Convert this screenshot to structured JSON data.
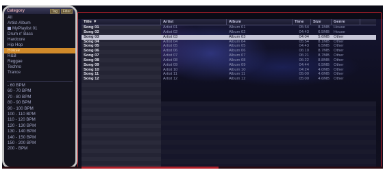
{
  "sidebar": {
    "title": "Category",
    "btn_tag": "Tag",
    "btn_filter": "Filter",
    "categories": [
      {
        "label": "All",
        "selected": false,
        "icon": ""
      },
      {
        "label": "Artist-Album",
        "selected": false,
        "icon": ""
      },
      {
        "label": "MyPlaylist 01",
        "selected": false,
        "icon": "playlist-icon"
      },
      {
        "label": "Drum n' Bass",
        "selected": false,
        "icon": ""
      },
      {
        "label": "Hardcore",
        "selected": false,
        "icon": ""
      },
      {
        "label": "Hip Hop",
        "selected": false,
        "icon": ""
      },
      {
        "label": "House",
        "selected": true,
        "icon": ""
      },
      {
        "label": "R&B",
        "selected": false,
        "icon": ""
      },
      {
        "label": "Reggae",
        "selected": false,
        "icon": ""
      },
      {
        "label": "Techno",
        "selected": false,
        "icon": ""
      },
      {
        "label": "Trance",
        "selected": false,
        "icon": ""
      }
    ],
    "bpm_ranges": [
      "- 60 BPM",
      "60 - 70 BPM",
      "70 - 80 BPM",
      "80 - 90 BPM",
      "90 - 100 BPM",
      "100 - 110 BPM",
      "110 - 120 BPM",
      "120 - 130 BPM",
      "130 - 140 BPM",
      "140 - 150 BPM",
      "150 - 200 BPM",
      "200 - BPM"
    ]
  },
  "table": {
    "columns": [
      {
        "key": "title",
        "label": "Title",
        "sort_indicator": "▼"
      },
      {
        "key": "artist",
        "label": "Artist",
        "sort_indicator": ""
      },
      {
        "key": "album",
        "label": "Album",
        "sort_indicator": ""
      },
      {
        "key": "time",
        "label": "Time",
        "sort_indicator": ""
      },
      {
        "key": "size",
        "label": "Size",
        "sort_indicator": ""
      },
      {
        "key": "genre",
        "label": "Genre",
        "sort_indicator": ""
      }
    ],
    "rows": [
      {
        "title": "Song 01",
        "artist": "Artist 01",
        "album": "Album 01",
        "time": "05:54",
        "size": "8.1MB",
        "genre": "House",
        "selected": false
      },
      {
        "title": "Song 02",
        "artist": "Artist 02",
        "album": "Album 02",
        "time": "04:43",
        "size": "6.5MB",
        "genre": "House",
        "selected": false
      },
      {
        "title": "Song 03",
        "artist": "Artist 03",
        "album": "Album 03",
        "time": "04:04",
        "size": "5.6MB",
        "genre": "Other",
        "selected": true
      },
      {
        "title": "Song 04",
        "artist": "Artist 04",
        "album": "Album 04",
        "time": "05:54",
        "size": "8.1MB",
        "genre": "Other",
        "selected": false
      },
      {
        "title": "Song 05",
        "artist": "Artist 05",
        "album": "Album 05",
        "time": "04:43",
        "size": "6.5MB",
        "genre": "Other",
        "selected": false
      },
      {
        "title": "Song 06",
        "artist": "Artist 06",
        "album": "Album 06",
        "time": "06:10",
        "size": "8.7MB",
        "genre": "Other",
        "selected": false
      },
      {
        "title": "Song 07",
        "artist": "Artist 07",
        "album": "Album 07",
        "time": "06:21",
        "size": "8.7MB",
        "genre": "Other",
        "selected": false
      },
      {
        "title": "Song 08",
        "artist": "Artist 08",
        "album": "Album 08",
        "time": "06:22",
        "size": "8.8MB",
        "genre": "Other",
        "selected": false
      },
      {
        "title": "Song 09",
        "artist": "Artist 09",
        "album": "Album 09",
        "time": "04:44",
        "size": "6.5MB",
        "genre": "Other",
        "selected": false
      },
      {
        "title": "Song 10",
        "artist": "Artist 10",
        "album": "Album 10",
        "time": "04:24",
        "size": "4.0MB",
        "genre": "Other",
        "selected": false
      },
      {
        "title": "Song 11",
        "artist": "Artist 11",
        "album": "Album 11",
        "time": "05:00",
        "size": "4.6MB",
        "genre": "Other",
        "selected": false
      },
      {
        "title": "Song 12",
        "artist": "Artist 12",
        "album": "Album 12",
        "time": "05:00",
        "size": "4.6MB",
        "genre": "Other",
        "selected": false
      }
    ]
  },
  "colors": {
    "accent": "#d08a2a",
    "frame_red": "#b0202a",
    "selected_row": "#c8c8d8"
  }
}
